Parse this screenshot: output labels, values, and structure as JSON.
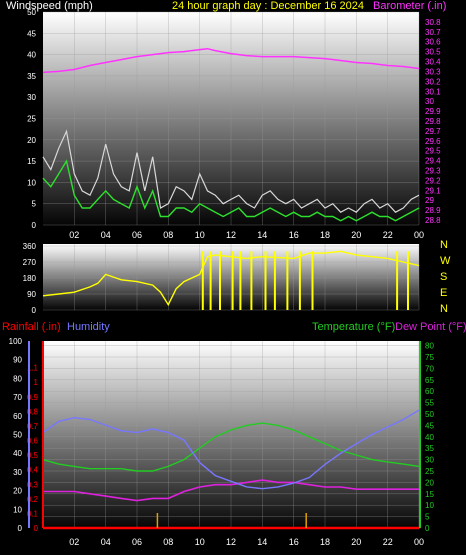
{
  "colors": {
    "wind": "#ffffff",
    "gust": "#d8d8d8",
    "avg": "#2de02d",
    "baro": "#ff33ff",
    "dir": "#ffff00",
    "hum": "#7777ff",
    "temp": "#22cc22",
    "dew": "#dd22dd",
    "rain": "#ff0000",
    "rainTick": "#e0a000",
    "text": "#ffffff"
  },
  "chart_data": [
    {
      "type": "line",
      "title": "24 hour graph day : December 16 2024",
      "legend_left": "Windspeed (mph)",
      "legend_right": "Barometer (.in)",
      "x_ticks": [
        "02",
        "04",
        "06",
        "08",
        "10",
        "12",
        "14",
        "16",
        "18",
        "20",
        "22",
        "00"
      ],
      "x_range": [
        0,
        24
      ],
      "y_left": {
        "range": [
          0,
          50
        ],
        "ticks": [
          "0",
          "5",
          "10",
          "15",
          "20",
          "25",
          "30",
          "35",
          "40",
          "45",
          "50"
        ]
      },
      "y_right": {
        "range": [
          28.75,
          30.9
        ],
        "ticks": [
          "28.8",
          "28.9",
          "29",
          "29.1",
          "29.2",
          "29.3",
          "29.4",
          "29.5",
          "29.6",
          "29.7",
          "29.8",
          "29.9",
          "30",
          "30.1",
          "30.2",
          "30.3",
          "30.4",
          "30.5",
          "30.6",
          "30.7",
          "30.8"
        ]
      },
      "series": [
        {
          "name": "Barometer",
          "axis": "right",
          "x": [
            0,
            1,
            2,
            3,
            4,
            5,
            6,
            7,
            8,
            9,
            10,
            10.5,
            11,
            12,
            13,
            14,
            15,
            16,
            17,
            18,
            19,
            20,
            21,
            22,
            23,
            24
          ],
          "values": [
            30.29,
            30.3,
            30.32,
            30.36,
            30.39,
            30.42,
            30.45,
            30.47,
            30.49,
            30.5,
            30.52,
            30.53,
            30.51,
            30.48,
            30.46,
            30.45,
            30.45,
            30.45,
            30.44,
            30.43,
            30.41,
            30.39,
            30.38,
            30.36,
            30.35,
            30.33
          ]
        },
        {
          "axis": "left",
          "x": [
            0,
            0.5,
            1,
            1.5,
            2,
            2.5,
            3,
            3.5,
            4,
            4.5,
            5,
            5.5,
            6,
            6.5,
            7,
            7.5,
            8,
            8.5,
            9,
            9.5,
            10,
            10.5,
            11,
            11.5,
            12,
            12.5,
            13,
            13.5,
            14,
            14.5,
            15,
            15.5,
            16,
            16.5,
            17,
            17.5,
            18,
            18.5,
            19,
            19.5,
            20,
            20.5,
            21,
            21.5,
            22,
            22.5,
            23,
            23.5,
            24
          ],
          "values": [
            16,
            13,
            18,
            22,
            12,
            8,
            7,
            11,
            19,
            12,
            9,
            8,
            17,
            8,
            16,
            4,
            5,
            9,
            8,
            6,
            12,
            8,
            7,
            5,
            6,
            7,
            5,
            4,
            7,
            8,
            6,
            5,
            6,
            4,
            5,
            6,
            4,
            5,
            3,
            4,
            3,
            5,
            6,
            4,
            5,
            3,
            4,
            6,
            7
          ]
        },
        {
          "axis": "left",
          "x": [
            0,
            0.5,
            1,
            1.5,
            2,
            2.5,
            3,
            3.5,
            4,
            4.5,
            5,
            5.5,
            6,
            6.5,
            7,
            7.5,
            8,
            8.5,
            9,
            9.5,
            10,
            10.5,
            11,
            11.5,
            12,
            12.5,
            13,
            13.5,
            14,
            14.5,
            15,
            15.5,
            16,
            16.5,
            17,
            17.5,
            18,
            18.5,
            19,
            19.5,
            20,
            20.5,
            21,
            21.5,
            22,
            22.5,
            23,
            23.5,
            24
          ],
          "values": [
            11,
            9,
            12,
            15,
            7,
            4,
            4,
            6,
            8,
            6,
            5,
            4,
            9,
            4,
            8,
            2,
            2,
            4,
            4,
            3,
            5,
            4,
            3,
            2,
            3,
            4,
            2,
            2,
            3,
            4,
            3,
            2,
            3,
            2,
            2,
            3,
            2,
            2,
            1,
            2,
            1,
            2,
            3,
            2,
            2,
            1,
            2,
            3,
            4
          ]
        }
      ]
    },
    {
      "type": "line",
      "legend_right": "N W S E N",
      "x_range": [
        0,
        24
      ],
      "y_left": {
        "range": [
          0,
          360
        ],
        "ticks": [
          "0",
          "90",
          "180",
          "270",
          "360"
        ]
      },
      "series": [
        {
          "name": "Wind Direction",
          "x": [
            0,
            1,
            2,
            3,
            3.5,
            4,
            5,
            6,
            7,
            7.5,
            8,
            8.5,
            9,
            10,
            10.5,
            11,
            12,
            13,
            14,
            15,
            16,
            17,
            18,
            19,
            20,
            21,
            22,
            23,
            24
          ],
          "values": [
            80,
            90,
            100,
            130,
            150,
            200,
            170,
            160,
            140,
            100,
            30,
            120,
            160,
            200,
            300,
            310,
            300,
            290,
            300,
            295,
            290,
            320,
            320,
            330,
            310,
            300,
            290,
            270,
            250
          ],
          "dropouts_x": [
            10.2,
            10.7,
            11.3,
            12.1,
            12.6,
            13.3,
            14.2,
            14.8,
            15.6,
            16.4,
            17.2,
            22.6,
            23.3
          ]
        }
      ]
    },
    {
      "type": "line",
      "legend_left": [
        "Rainfall (.in)",
        "Humidity"
      ],
      "legend_right": [
        "Temperature (°F)",
        "Dew Point (°F)"
      ],
      "x_ticks": [
        "02",
        "04",
        "06",
        "08",
        "10",
        "12",
        "14",
        "16",
        "18",
        "20",
        "22",
        "00"
      ],
      "x_range": [
        0,
        24
      ],
      "y_humidity": {
        "range": [
          0,
          100
        ],
        "ticks": [
          "0",
          "10",
          "20",
          "30",
          "40",
          "50",
          "60",
          "70",
          "80",
          "90",
          "100"
        ]
      },
      "y_rain": {
        "range": [
          0,
          1.2
        ],
        "ticks": [
          "0",
          "0.1",
          "0.2",
          "0.3",
          "0.4",
          "0.5",
          "0.6",
          "0.7",
          "0.8",
          "0.9",
          "1",
          "1.1"
        ]
      },
      "y_temp": {
        "range": [
          0,
          82
        ],
        "ticks": [
          "0",
          "5",
          "10",
          "15",
          "20",
          "25",
          "30",
          "35",
          "40",
          "45",
          "50",
          "55",
          "60",
          "65",
          "70",
          "75",
          "80"
        ]
      },
      "series": [
        {
          "name": "Humidity",
          "axis": "humidity",
          "x": [
            0,
            1,
            2,
            3,
            4,
            5,
            6,
            7,
            8,
            9,
            10,
            11,
            12,
            13,
            14,
            15,
            16,
            17,
            18,
            19,
            20,
            21,
            22,
            23,
            24
          ],
          "values": [
            51,
            57,
            59,
            58,
            55,
            52,
            51,
            53,
            51,
            47,
            35,
            28,
            25,
            22,
            21,
            22,
            24,
            27,
            34,
            40,
            45,
            50,
            54,
            58,
            63
          ]
        },
        {
          "name": "Temperature",
          "axis": "temp",
          "x": [
            0,
            1,
            2,
            3,
            4,
            5,
            6,
            7,
            8,
            9,
            10,
            11,
            12,
            13,
            14,
            15,
            16,
            17,
            18,
            19,
            20,
            21,
            22,
            23,
            24
          ],
          "values": [
            30,
            28,
            27,
            26,
            26,
            26,
            25,
            25,
            27,
            30,
            35,
            40,
            43,
            45,
            46,
            45,
            43,
            40,
            37,
            34,
            32,
            30,
            29,
            28,
            27
          ]
        },
        {
          "name": "Dew Point",
          "axis": "temp",
          "x": [
            0,
            1,
            2,
            3,
            4,
            5,
            6,
            7,
            8,
            9,
            10,
            11,
            12,
            13,
            14,
            15,
            16,
            17,
            18,
            19,
            20,
            21,
            22,
            23,
            24
          ],
          "values": [
            16,
            16,
            16,
            15,
            14,
            13,
            12,
            13,
            13,
            16,
            18,
            19,
            19,
            20,
            21,
            20,
            20,
            19,
            18,
            18,
            17,
            17,
            17,
            17,
            17
          ]
        },
        {
          "name": "Rainfall",
          "axis": "rain",
          "x": [
            0,
            24
          ],
          "values": [
            0,
            0
          ],
          "events_x": [
            7.3,
            16.8
          ]
        }
      ]
    }
  ]
}
